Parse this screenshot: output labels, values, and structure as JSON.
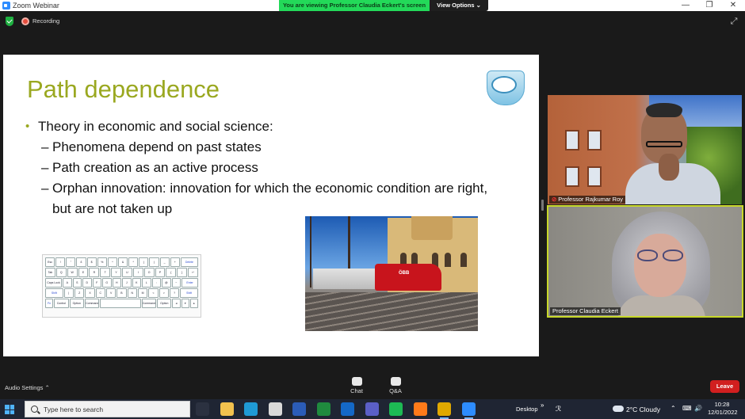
{
  "window": {
    "title": "Zoom Webinar",
    "controls": {
      "minimize": "—",
      "restore": "❐",
      "close": "✕"
    }
  },
  "share_banner": {
    "text": "You are viewing Professor Claudia Eckert's screen",
    "view_options": "View Options ⌄"
  },
  "status": {
    "recording_label": "Recording",
    "expand_glyph": "⤢"
  },
  "slide": {
    "title": "Path dependence",
    "bullets": [
      {
        "level": 1,
        "text": "Theory in economic and social science:"
      },
      {
        "level": 2,
        "dash": "–",
        "text": "Phenomena depend on past states"
      },
      {
        "level": 2,
        "dash": "–",
        "text": "Path creation as an active process"
      },
      {
        "level": 2,
        "dash": "–",
        "text": "Orphan innovation: innovation for which the economic condition are right, but are not taken up"
      }
    ],
    "keyboard_rows": [
      [
        "Esc",
        "!",
        "\"",
        "£",
        "$",
        "%",
        "^",
        "&",
        "*",
        "(",
        ")",
        "_",
        "+",
        "Delete"
      ],
      [
        "Tab",
        "Q",
        "W",
        "E",
        "R",
        "T",
        "Y",
        "U",
        "I",
        "O",
        "P",
        "{",
        "}",
        "↵"
      ],
      [
        "Caps Lock",
        "A",
        "S",
        "D",
        "F",
        "G",
        "H",
        "J",
        "K",
        "L",
        ":",
        "@",
        "~",
        "Enter"
      ],
      [
        "Shift",
        "|",
        "Z",
        "X",
        "C",
        "V",
        "B",
        "N",
        "M",
        "<",
        ">",
        "?",
        "Shift"
      ],
      [
        "Fn",
        "Control",
        "Option",
        "Command",
        "",
        "Command",
        "Option",
        "◂",
        "▾",
        "▸"
      ]
    ]
  },
  "participants": [
    {
      "name": "Professor Rajkumar Roy",
      "mic_muted": true
    },
    {
      "name": "Professor Claudia Eckert",
      "mic_muted": false
    }
  ],
  "toolbar": {
    "audio_settings": "Audio Settings ⌃",
    "chat": "Chat",
    "qa": "Q&A",
    "leave": "Leave"
  },
  "taskbar": {
    "search_placeholder": "Type here to search",
    "desktop": "Desktop",
    "desktop_chevron": "»",
    "weather": "2°C  Cloudy",
    "time": "10:28",
    "date": "12/01/2022",
    "tray_glyphs": [
      "⌃",
      "⌨",
      "🔊"
    ],
    "people_glyph": "ℛ",
    "apps": [
      {
        "name": "task-view",
        "color": "#2b3140"
      },
      {
        "name": "file-explorer",
        "color": "#f2c14e"
      },
      {
        "name": "edge",
        "color": "#1f9ad6"
      },
      {
        "name": "store",
        "color": "#d9d9d9"
      },
      {
        "name": "word",
        "color": "#2b5cb8"
      },
      {
        "name": "money-app",
        "color": "#1f8a3e"
      },
      {
        "name": "outlook",
        "color": "#1468c7"
      },
      {
        "name": "teams",
        "color": "#5b5fc7"
      },
      {
        "name": "spotify",
        "color": "#1db954"
      },
      {
        "name": "firefox",
        "color": "#ff7a1a"
      },
      {
        "name": "chrome",
        "color": "#e0a800"
      },
      {
        "name": "zoom",
        "color": "#2d8cff"
      }
    ]
  }
}
